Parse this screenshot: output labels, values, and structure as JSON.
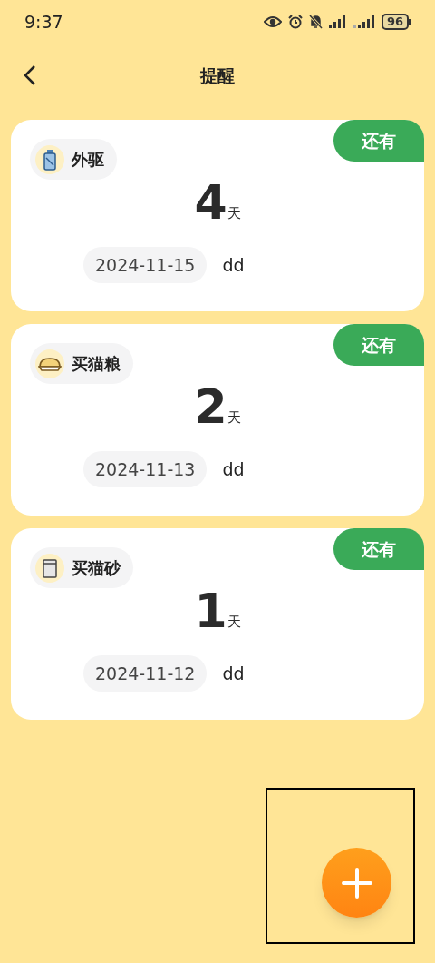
{
  "status_bar": {
    "time": "9:37",
    "battery": "96"
  },
  "header": {
    "title": "提醒"
  },
  "reminders": [
    {
      "name": "外驱",
      "badge": "还有",
      "count": "4",
      "unit": "天",
      "date": "2024-11-15",
      "note": "dd"
    },
    {
      "name": "买猫粮",
      "badge": "还有",
      "count": "2",
      "unit": "天",
      "date": "2024-11-13",
      "note": "dd"
    },
    {
      "name": "买猫砂",
      "badge": "还有",
      "count": "1",
      "unit": "天",
      "date": "2024-11-12",
      "note": "dd"
    }
  ]
}
